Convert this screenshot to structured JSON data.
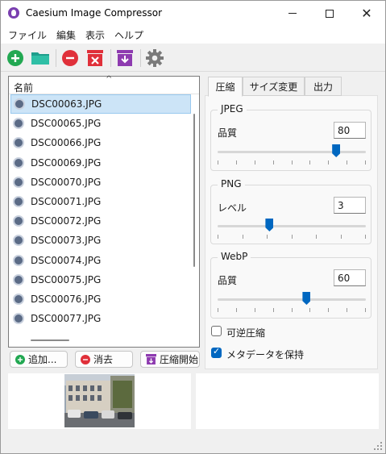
{
  "window": {
    "title": "Caesium Image Compressor"
  },
  "menu": [
    "ファイル",
    "編集",
    "表示",
    "ヘルプ"
  ],
  "toolbar": {
    "buttons": [
      "add-icon",
      "open-folder-icon",
      "remove-icon",
      "clear-list-icon",
      "compress-icon",
      "settings-icon"
    ]
  },
  "file_list": {
    "header": "名前",
    "sort_indicator": "^",
    "selected_index": 0,
    "files": [
      "DSC00063.JPG",
      "DSC00065.JPG",
      "DSC00066.JPG",
      "DSC00069.JPG",
      "DSC00070.JPG",
      "DSC00071.JPG",
      "DSC00072.JPG",
      "DSC00073.JPG",
      "DSC00074.JPG",
      "DSC00075.JPG",
      "DSC00076.JPG",
      "DSC00077.JPG"
    ]
  },
  "buttons": {
    "add": "追加...",
    "remove": "消去",
    "compress": "圧縮開始"
  },
  "tabs": [
    "圧縮",
    "サイズ変更",
    "出力"
  ],
  "active_tab": 0,
  "jpeg": {
    "title": "JPEG",
    "label": "品質",
    "value": "80",
    "level": 0.8
  },
  "png": {
    "title": "PNG",
    "label": "レベル",
    "value": "3",
    "level": 0.35
  },
  "webp": {
    "title": "WebP",
    "label": "品質",
    "value": "60",
    "level": 0.6
  },
  "options": {
    "lossless": {
      "label": "可逆圧縮",
      "checked": false
    },
    "keep_metadata": {
      "label": "メタデータを保持",
      "checked": true
    }
  },
  "colors": {
    "accent": "#0067c0",
    "add": "#22a852",
    "remove": "#e0303a",
    "compress": "#8e3bb0",
    "folder": "#2bb8a0"
  }
}
